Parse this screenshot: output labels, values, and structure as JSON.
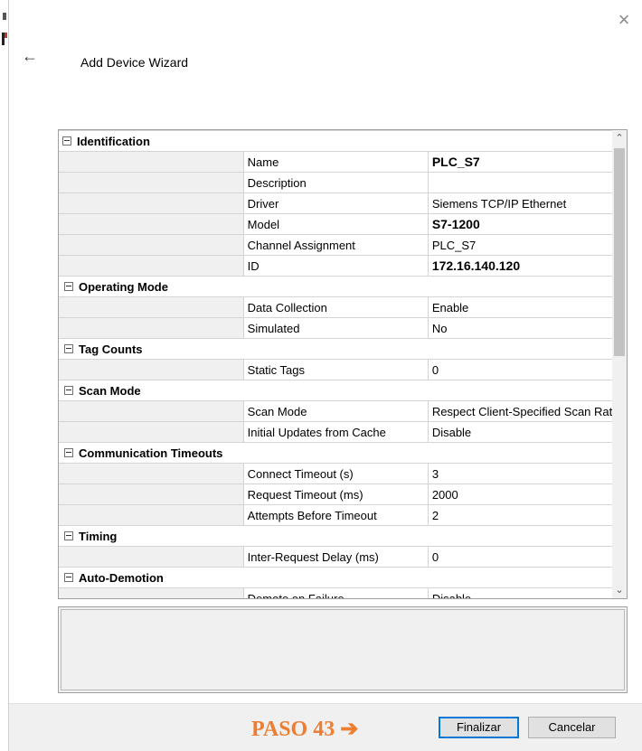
{
  "dialog": {
    "title": "Add Device Wizard",
    "close_icon": "close-icon",
    "back_icon": "back-arrow-icon"
  },
  "grid": {
    "rows": [
      {
        "type": "category",
        "label": "Identification"
      },
      {
        "type": "property",
        "name": "Name",
        "value": "PLC_S7",
        "bold": true
      },
      {
        "type": "property",
        "name": "Description",
        "value": ""
      },
      {
        "type": "property",
        "name": "Driver",
        "value": "Siemens TCP/IP Ethernet"
      },
      {
        "type": "property",
        "name": "Model",
        "value": "S7-1200",
        "bold": true
      },
      {
        "type": "property",
        "name": "Channel Assignment",
        "value": "PLC_S7"
      },
      {
        "type": "property",
        "name": "ID",
        "value": "172.16.140.120",
        "bold": true
      },
      {
        "type": "category",
        "label": "Operating Mode"
      },
      {
        "type": "property",
        "name": "Data Collection",
        "value": "Enable"
      },
      {
        "type": "property",
        "name": "Simulated",
        "value": "No"
      },
      {
        "type": "category",
        "label": "Tag Counts"
      },
      {
        "type": "property",
        "name": "Static Tags",
        "value": "0"
      },
      {
        "type": "category",
        "label": "Scan Mode"
      },
      {
        "type": "property",
        "name": "Scan Mode",
        "value": "Respect Client-Specified Scan Rate"
      },
      {
        "type": "property",
        "name": "Initial Updates from Cache",
        "value": "Disable"
      },
      {
        "type": "category",
        "label": "Communication Timeouts"
      },
      {
        "type": "property",
        "name": "Connect Timeout (s)",
        "value": "3"
      },
      {
        "type": "property",
        "name": "Request Timeout (ms)",
        "value": "2000"
      },
      {
        "type": "property",
        "name": "Attempts Before Timeout",
        "value": "2"
      },
      {
        "type": "category",
        "label": "Timing"
      },
      {
        "type": "property",
        "name": "Inter-Request Delay (ms)",
        "value": "0"
      },
      {
        "type": "category",
        "label": "Auto-Demotion"
      },
      {
        "type": "property",
        "name": "Demote on Failure",
        "value": "Disable"
      }
    ]
  },
  "footer": {
    "annotation": "PASO 43 ➔",
    "finish_label": "Finalizar",
    "cancel_label": "Cancelar"
  },
  "colors": {
    "annotation": "#ed7d31",
    "primary_border": "#0078d7",
    "footer_bg": "#f0f0f0"
  }
}
